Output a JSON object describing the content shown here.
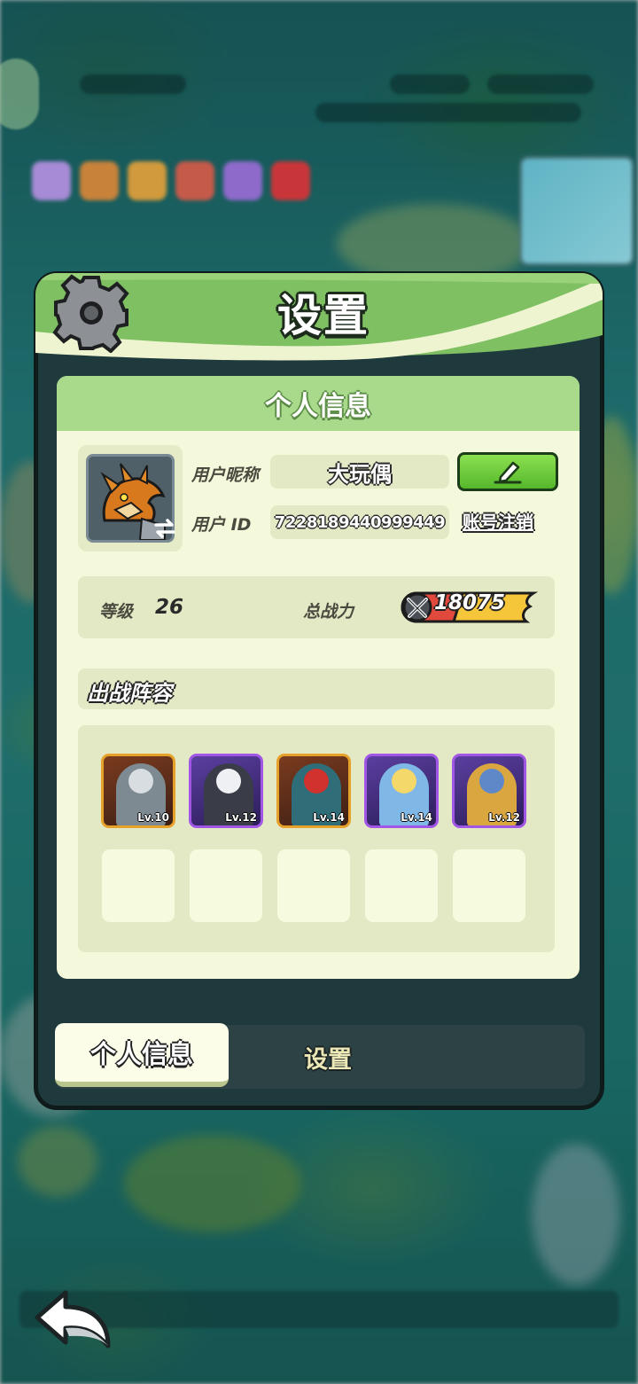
{
  "panel": {
    "title": "设置"
  },
  "section": {
    "header": "个人信息"
  },
  "profile": {
    "nickname_label": "用户昵称",
    "nickname": "大玩偶",
    "uid_label": "用户  ID",
    "uid": "7228189440999449",
    "cancel_account": "账号注销",
    "level_label": "等级",
    "level": "26",
    "power_label": "总战力",
    "power": "18075"
  },
  "lineup": {
    "title": "出战阵容",
    "heroes": [
      {
        "level": "Lv.10",
        "rarity": "gold"
      },
      {
        "level": "Lv.12",
        "rarity": "purple"
      },
      {
        "level": "Lv.14",
        "rarity": "gold"
      },
      {
        "level": "Lv.14",
        "rarity": "purple"
      },
      {
        "level": "Lv.12",
        "rarity": "purple"
      }
    ],
    "empty_slots": 5
  },
  "tabs": {
    "personal_info": "个人信息",
    "settings": "设置",
    "active": "personal_info"
  },
  "icons": {
    "gear": "gear-icon",
    "edit": "pencil-icon",
    "swap_avatar": "swap-arrows-icon",
    "power": "crossed-swords-icon",
    "back": "back-arrow-icon"
  },
  "colors": {
    "header_green": "#a9d98b",
    "panel_cream": "#f5f9dc",
    "edit_button_green": "#56b72c",
    "power_badge_yellow": "#f6c63a",
    "rare_border_purple": "#a256e6",
    "rare_border_gold": "#e6a12a"
  }
}
